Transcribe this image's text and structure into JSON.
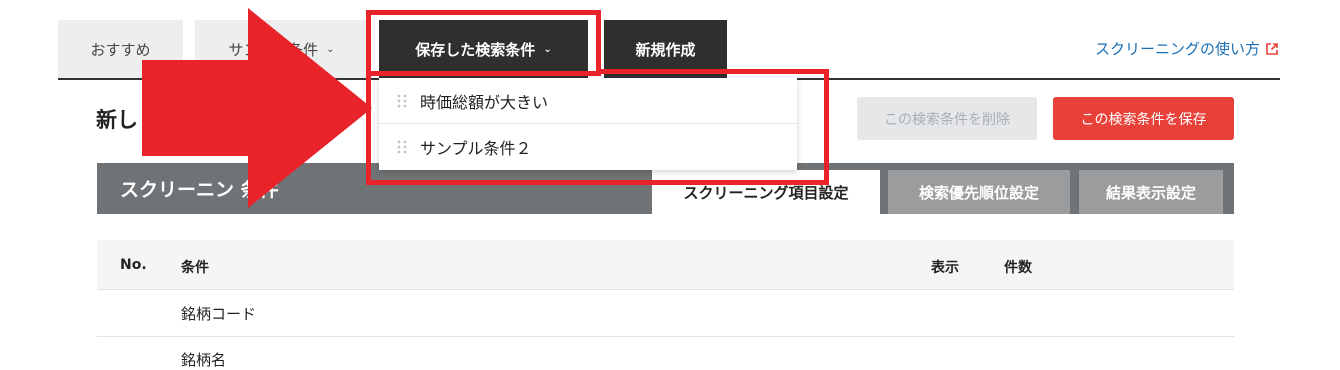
{
  "tabs": {
    "recommended": "おすすめ",
    "sample": "サンプル条件",
    "saved": "保存した検索条件",
    "new": "新規作成"
  },
  "help_link": "スクリーニングの使い方",
  "page_title": "新し",
  "buttons": {
    "delete": "この検索条件を削除",
    "save": "この検索条件を保存"
  },
  "panel": {
    "title": "スクリーニン 条件",
    "sub_tabs": [
      "スクリーニング項目設定",
      "検索優先順位設定",
      "結果表示設定"
    ]
  },
  "table": {
    "headers": {
      "no": "No.",
      "condition": "条件",
      "display": "表示",
      "count": "件数"
    },
    "rows": [
      "銘柄コード",
      "銘柄名"
    ]
  },
  "dropdown": {
    "items": [
      "時価総額が大きい",
      "サンプル条件２"
    ]
  },
  "colors": {
    "accent_red": "#e8413a",
    "annotation_red": "#e8232a",
    "link_blue": "#1a6fb5",
    "dark_tab": "#2f2f2f"
  }
}
